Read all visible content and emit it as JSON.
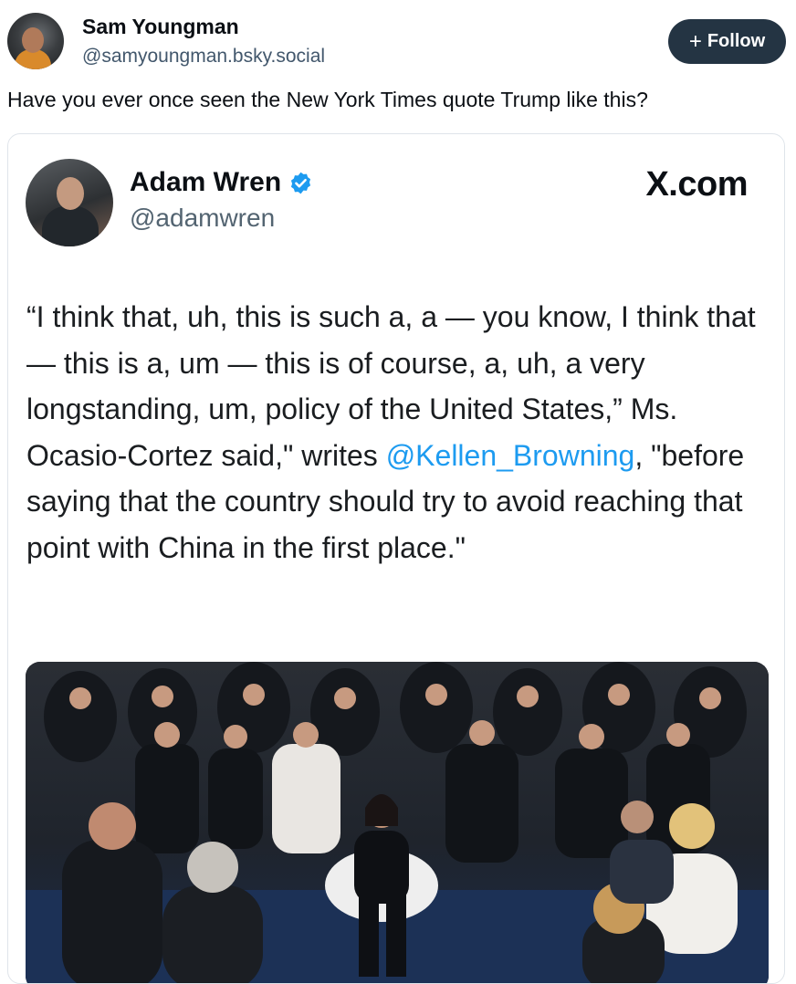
{
  "post": {
    "author_name": "Sam Youngman",
    "author_handle": "@samyoungman.bsky.social",
    "follow_label": "Follow",
    "follow_icon": "plus-icon",
    "text": "Have you ever once seen the New York Times quote Trump like this?"
  },
  "quoted": {
    "author_name": "Adam Wren",
    "author_handle": "@adamwren",
    "verified_icon": "verified-badge-icon",
    "source_label": "X.com",
    "body_part1": "“I think that, uh, this is such a, a — you know, I think that — this is a, um — this is of course, a, uh, a very longstanding, um, policy of the United States,” Ms. Ocasio-Cortez said,\" writes ",
    "mention": "@Kellen_Browning",
    "body_part2": ", \"before saying that the country should try to avoid reaching that point with China in the first place.\"",
    "mention_color": "#1d9bf0"
  },
  "colors": {
    "follow_bg": "#243443",
    "handle": "#42576c",
    "verified": "#1d9bf0"
  }
}
